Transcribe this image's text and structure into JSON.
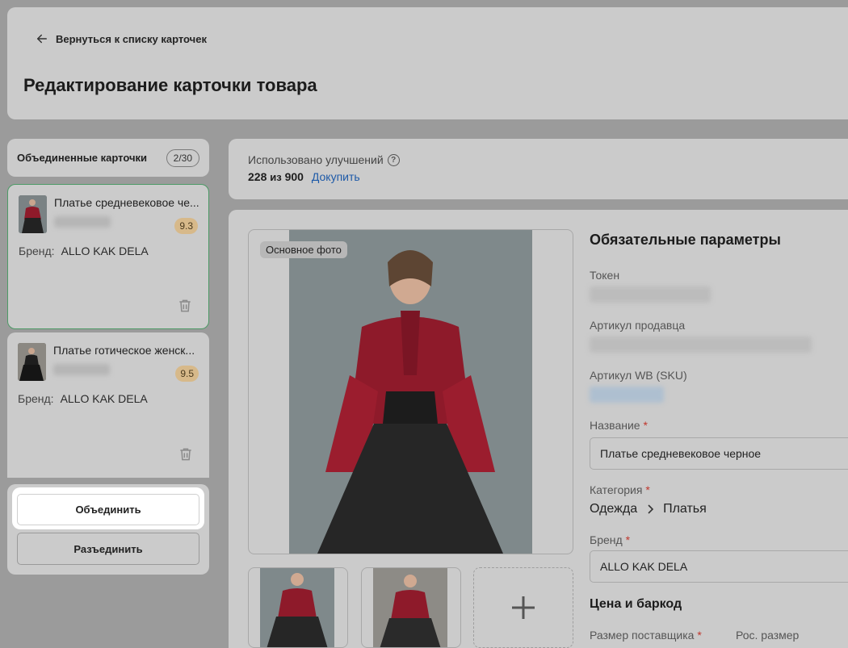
{
  "header": {
    "back_label": "Вернуться к списку карточек",
    "title": "Редактирование карточки товара"
  },
  "merged": {
    "title": "Объединенные карточки",
    "count": "2/30",
    "cards": [
      {
        "name": "Платье средневековое че...",
        "rating": "9.3",
        "brand_label": "Бренд:",
        "brand": "ALLO KAK DELA"
      },
      {
        "name": "Платье готическое женск...",
        "rating": "9.5",
        "brand_label": "Бренд:",
        "brand": "ALLO KAK DELA"
      }
    ],
    "merge_button": "Объединить",
    "split_button": "Разъединить"
  },
  "improvements": {
    "label": "Использовано улучшений",
    "used": "228",
    "of": "из",
    "total": "900",
    "buy": "Докупить"
  },
  "editor": {
    "photo_tag": "Основное фото",
    "required_title": "Обязательные параметры",
    "token_label": "Токен",
    "seller_article_label": "Артикул продавца",
    "wb_sku_label": "Артикул WB (SKU)",
    "name_label": "Название",
    "name_value": "Платье средневековое черное",
    "category_label": "Категория",
    "category_path": [
      "Одежда",
      "Платья"
    ],
    "brand_label": "Бренд",
    "brand_value": "ALLO KAK DELA",
    "price_title": "Цена и баркод",
    "supplier_size_label": "Размер поставщика",
    "ru_size_label": "Рос. размер",
    "required_mark": "*"
  },
  "colors": {
    "accent_link": "#1e5aa8",
    "selected_border": "#4d9a66",
    "required": "#c0362c",
    "rating_badge": "#d7b98a"
  },
  "icons": [
    "arrow-left-icon",
    "help-icon",
    "trash-icon",
    "chevron-right-icon",
    "plus-icon"
  ]
}
